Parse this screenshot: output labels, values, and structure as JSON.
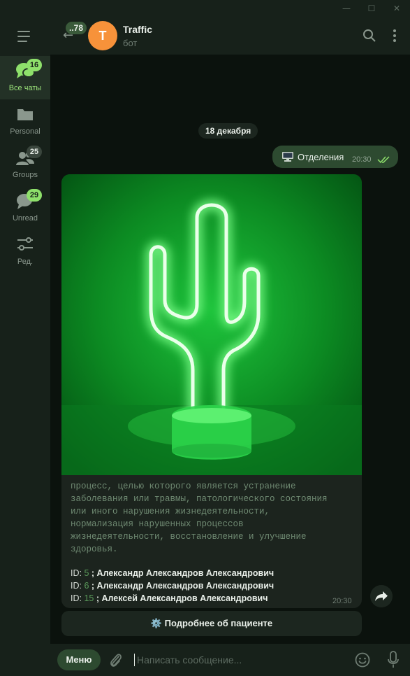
{
  "window": {
    "minimize": "—",
    "maximize": "☐",
    "close": "✕"
  },
  "sidebar": {
    "items": [
      {
        "label": "Все чаты",
        "badge": "16",
        "icon": "chats-icon",
        "active": true
      },
      {
        "label": "Personal",
        "badge": "",
        "icon": "folder-icon"
      },
      {
        "label": "Groups",
        "badge": "25",
        "icon": "groups-icon"
      },
      {
        "label": "Unread",
        "badge": "29",
        "icon": "unread-icon"
      },
      {
        "label": "Ред.",
        "badge": "",
        "icon": "sliders-icon"
      }
    ]
  },
  "header": {
    "back_badge": "..78",
    "avatar_letter": "T",
    "title": "Traffic",
    "subtitle": "бот"
  },
  "chat": {
    "date": "18 декабря",
    "outgoing": {
      "text": "Отделения",
      "time": "20:30",
      "status": "read"
    },
    "incoming": {
      "caption": "процесс, целью которого является устранение\nзаболевания или травмы, патологического состояния\nили иного нарушения жизнедеятельности,\nнормализация нарушенных процессов\nжизнедеятельности, восстановление и улучшение\nздоровья.",
      "ids": [
        {
          "prefix": "ID:",
          "num": "5",
          "name": "; Александр Александров Александрович"
        },
        {
          "prefix": "ID:",
          "num": "6",
          "name": "; Александр Александров Александрович"
        },
        {
          "prefix": "ID:",
          "num": "15",
          "name": "; Алексей Александров Александрович"
        }
      ],
      "time": "20:30"
    },
    "inline_button": "⚙️ Подробнее об пациенте"
  },
  "composer": {
    "menu_label": "Меню",
    "placeholder": "Написать сообщение..."
  },
  "colors": {
    "accent": "#8ee06b",
    "bubble_out": "#2d4a30",
    "avatar": "#f7923a"
  }
}
